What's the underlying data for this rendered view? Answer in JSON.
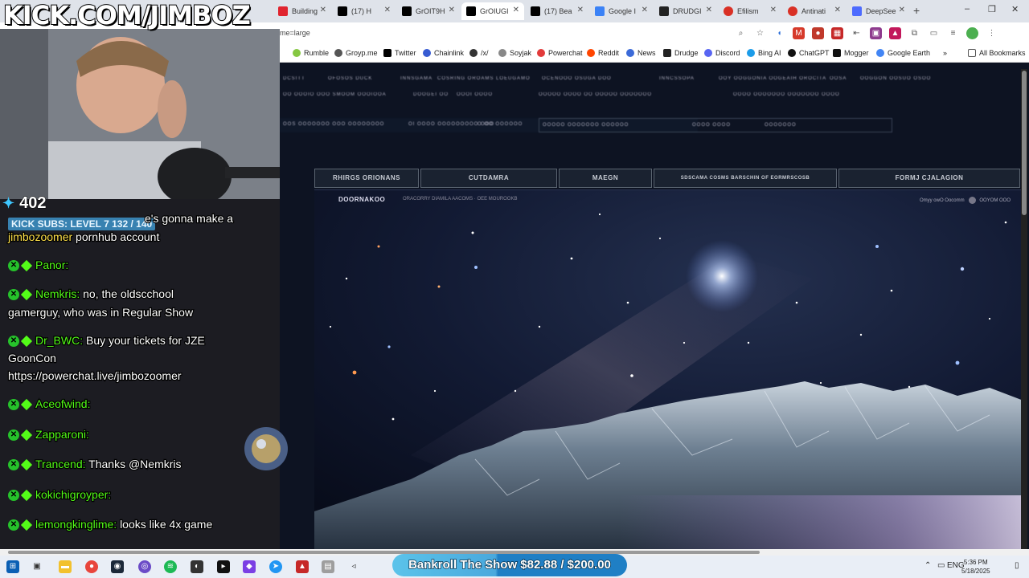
{
  "browser": {
    "tabs": [
      {
        "label": "Building",
        "color": "#e0242e"
      },
      {
        "label": "(17) H",
        "color": "#000000"
      },
      {
        "label": "GrOIT9H",
        "color": "#000000"
      },
      {
        "label": "GrOIUGI",
        "color": "#000000"
      },
      {
        "label": "(17) Bea",
        "color": "#000000"
      },
      {
        "label": "Google I",
        "color": "#3b82f6"
      },
      {
        "label": "DRUDGI",
        "color": "#000000"
      },
      {
        "label": "Efilism",
        "color": "#d93025"
      },
      {
        "label": "Antinati",
        "color": "#d93025"
      },
      {
        "label": "DeepSee",
        "color": "#4d6bfe"
      }
    ],
    "new_tab_label": "+",
    "address": "me=large",
    "window_controls": [
      "–",
      "❐",
      "✕"
    ],
    "bookmarks": [
      {
        "label": "Rumble",
        "color": "#85c742"
      },
      {
        "label": "Groyp.me",
        "color": "#555555"
      },
      {
        "label": "Twitter",
        "color": "#000000"
      },
      {
        "label": "Chainlink",
        "color": "#375bd2"
      },
      {
        "label": "/x/",
        "color": "#333333"
      },
      {
        "label": "Soyjak",
        "color": "#888888"
      },
      {
        "label": "Powerchat",
        "color": "#e23b3b"
      },
      {
        "label": "Reddit",
        "color": "#ff4500"
      },
      {
        "label": "News",
        "color": "#3b6ad8"
      },
      {
        "label": "Drudge",
        "color": "#222222"
      },
      {
        "label": "Discord",
        "color": "#5865f2"
      },
      {
        "label": "Bing AI",
        "color": "#1c9ce9"
      },
      {
        "label": "ChatGPT",
        "color": "#111111"
      },
      {
        "label": "Mogger",
        "color": "#111111"
      },
      {
        "label": "Google Earth",
        "color": "#4285f4"
      }
    ],
    "more_bookmarks": "»",
    "all_bookmarks": "All Bookmarks"
  },
  "page": {
    "tabs": [
      "RHIRGS ORIONANS",
      "CUTDAMRA",
      "MAEGN",
      "SDSCAMA COSMS BARSCHIN OF EORMRSCOSB",
      "FORMJ CJALAGION"
    ],
    "panel_title": "DOORNAKOO",
    "panel_sub": "ORACORRY DIAMILA AACOMS · OEE MOUROOKB",
    "panel_right": "Omyy owO Oocomm",
    "panel_right2": "OOYOM OOO",
    "nav_rows": [
      [
        "DCSITT",
        "OFOSOS DUCK",
        "INNSGAMA",
        "COSRING OROAMS LOEUGAMO",
        "OCENOOO OSUGA DOO",
        "INNCSSOPA",
        "OOY OOGGONIA OOGEAIH OROCITA",
        "OOSA",
        "OOGGON OOSUO OSOO"
      ],
      [
        "OO OOOIO OOO SMOOM OOOIOOA",
        "DOOGEI OO",
        "OOOI OOOO",
        "OOOOO OOOO OO OOOOO OOOOOOO",
        "OOOO OOOOOOO OOOOOOO OOOO"
      ],
      [
        "OOS OOOOOOO OOO OOOOOOOO",
        "OI OOOO OOOOOOOOO OOO",
        "O OO OOOOOO",
        "OOOOO OOOOOOO OOOOOO",
        "OOOO OOOO",
        "OOOOOOO"
      ]
    ]
  },
  "stream": {
    "channel_title": "KICK.COM/JIMBOZ",
    "viewer_count": "402",
    "subs_goal": "KICK SUBS: LEVEL 7  132 / 140",
    "messages": [
      {
        "user": "",
        "text": "e's gonna make a",
        "user_color": "#53fc18"
      },
      {
        "user": "jimbozoomer",
        "text": "pornhub account",
        "user_color": "#ffe14a"
      },
      {
        "user": "Panor:",
        "text": "",
        "user_color": "#53fc18"
      },
      {
        "user": "Nemkris:",
        "text": "no, the oldscchool",
        "user_color": "#53fc18"
      },
      {
        "user": "",
        "text": "gamerguy, who was in Regular Show",
        "user_color": "#53fc18"
      },
      {
        "user": "Dr_BWC:",
        "text": "Buy your tickets for JZE",
        "user_color": "#53fc18"
      },
      {
        "user": "",
        "text": "GoonCon",
        "user_color": "#53fc18"
      },
      {
        "user": "",
        "text": "https://powerchat.live/jimbozoomer",
        "user_color": "#53fc18"
      },
      {
        "user": "Aceofwind:",
        "text": "",
        "user_color": "#53fc18"
      },
      {
        "user": "Zapparoni:",
        "text": "",
        "user_color": "#53fc18"
      },
      {
        "user": "Trancend:",
        "text": "Thanks @Nemkris",
        "user_color": "#53fc18"
      },
      {
        "user": "kokichigroyper:",
        "text": "",
        "user_color": "#53fc18"
      },
      {
        "user": "lemongkinglime:",
        "text": "looks like 4x game",
        "user_color": "#53fc18"
      }
    ],
    "bankroll": "Bankroll The Show $82.88 / $200.00"
  },
  "taskbar": {
    "tray_lang": "ENG",
    "time": "5:36 PM",
    "date": "5/18/2025"
  },
  "colors": {
    "kick_green": "#53fc18",
    "bankroll_blue": "#1f7fc5",
    "page_bg": "#0d1322"
  }
}
